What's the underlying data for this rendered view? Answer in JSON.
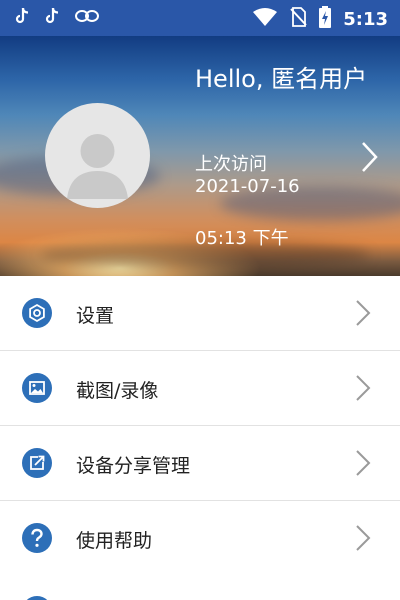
{
  "status_bar": {
    "time": "5:13",
    "left_icons": [
      "tiktok-icon",
      "tiktok-icon",
      "link-icon"
    ],
    "right_icons": [
      "wifi-icon",
      "no-sim-icon",
      "battery-charging-icon"
    ]
  },
  "profile": {
    "greeting": "Hello, 匿名用户",
    "last_visit_label": "上次访问",
    "last_visit_date": "2021-07-16",
    "last_visit_time": "05:13 下午"
  },
  "menu": [
    {
      "label": "设置",
      "icon": "gear-icon"
    },
    {
      "label": "截图/录像",
      "icon": "image-icon"
    },
    {
      "label": "设备分享管理",
      "icon": "share-icon"
    },
    {
      "label": "使用帮助",
      "icon": "help-icon"
    }
  ],
  "colors": {
    "status_bar": "#2a57a8",
    "accent": "#2d6fb8"
  }
}
